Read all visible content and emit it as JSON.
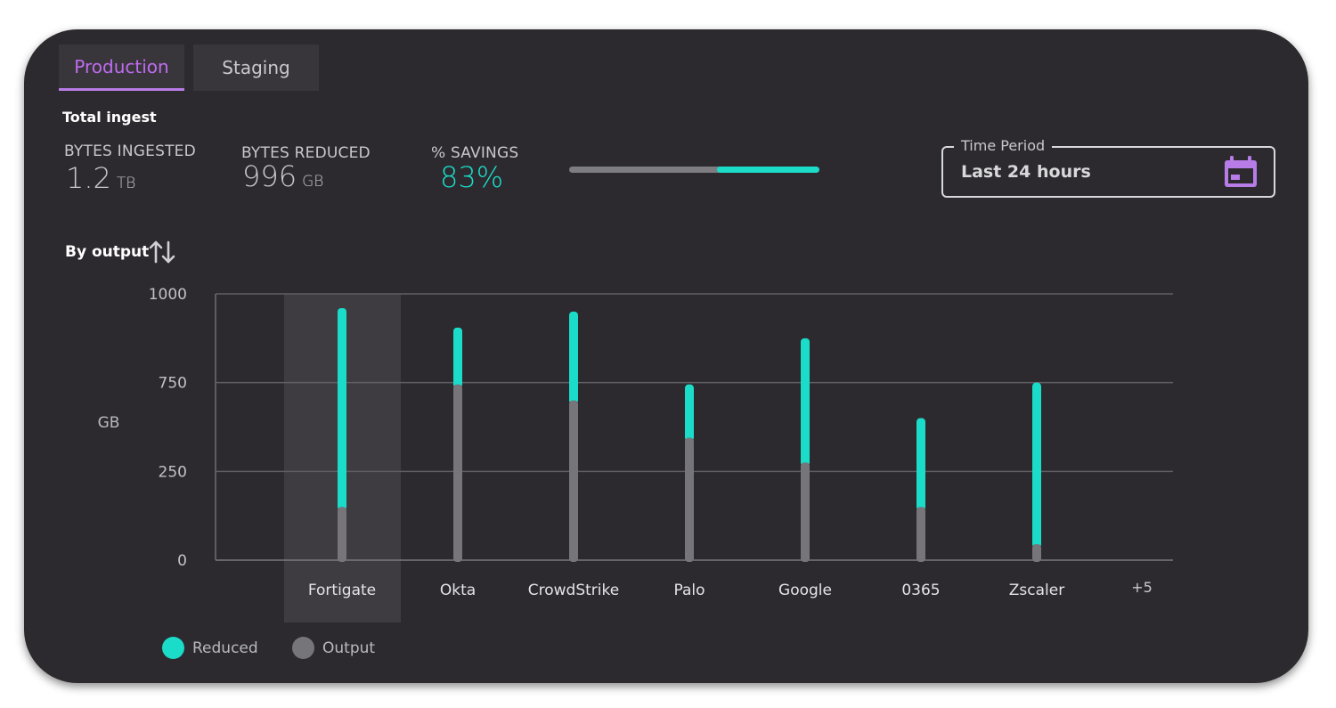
{
  "tabs": [
    {
      "label": "Production",
      "active": true
    },
    {
      "label": "Staging",
      "active": false
    }
  ],
  "summary": {
    "title": "Total ingest",
    "bytes_ingested": {
      "label": "BYTES INGESTED",
      "value": "1.2",
      "unit": "TB"
    },
    "bytes_reduced": {
      "label": "BYTES REDUCED",
      "value": "996",
      "unit": "GB"
    },
    "savings": {
      "label": "% SAVINGS",
      "value": "83%",
      "fraction": 0.41
    }
  },
  "time_period": {
    "legend": "Time Period",
    "value": "Last 24 hours",
    "icon": "calendar-icon"
  },
  "section": {
    "title": "By output",
    "sort_icon": "sort-arrows-icon"
  },
  "colors": {
    "accent": "#1bdcc8",
    "output": "#76757a",
    "tab_active": "#c06cf0",
    "calendar": "#b87ce8"
  },
  "chart_data": {
    "type": "bar",
    "ylabel": "GB",
    "ylim": [
      0,
      1000
    ],
    "yticks": [
      {
        "value": 0,
        "label": "0"
      },
      {
        "value": 250,
        "label": "250"
      },
      {
        "value": 500,
        "label": "750"
      },
      {
        "value": 750,
        "label": "1000"
      }
    ],
    "categories": [
      "Fortigate",
      "Okta",
      "CrowdStrike",
      "Palo",
      "Google",
      "0365",
      "Zscaler"
    ],
    "more_label": "+5",
    "highlighted": "Fortigate",
    "series": [
      {
        "name": "Reduced",
        "values": [
          560,
          160,
          250,
          150,
          350,
          250,
          455
        ],
        "color": "#1bdcc8"
      },
      {
        "name": "Output",
        "values": [
          150,
          495,
          450,
          345,
          275,
          150,
          45
        ],
        "color": "#76757a"
      }
    ]
  }
}
